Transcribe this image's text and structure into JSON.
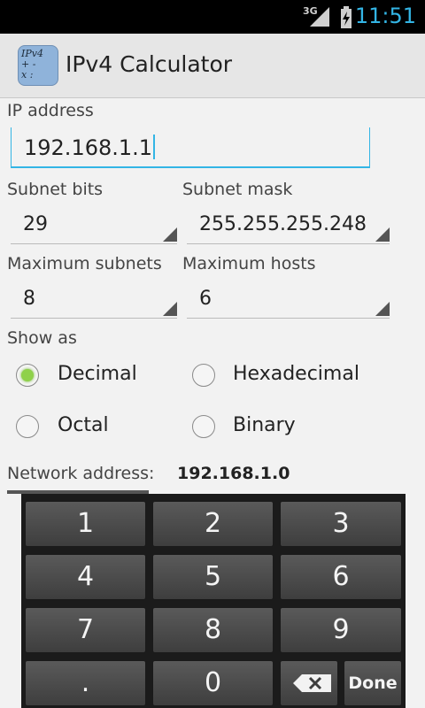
{
  "status_bar": {
    "network": "3G",
    "time": "11:51"
  },
  "app": {
    "title": "IPv4 Calculator",
    "icon_text": "IPv4\n+ -\nx :"
  },
  "ip": {
    "label": "IP address",
    "value": "192.168.1.1"
  },
  "subnet_bits": {
    "label": "Subnet bits",
    "value": "29"
  },
  "subnet_mask": {
    "label": "Subnet mask",
    "value": "255.255.255.248"
  },
  "max_subnets": {
    "label": "Maximum subnets",
    "value": "8"
  },
  "max_hosts": {
    "label": "Maximum hosts",
    "value": "6"
  },
  "show_as": {
    "label": "Show as",
    "options": [
      "Decimal",
      "Hexadecimal",
      "Octal",
      "Binary"
    ],
    "selected": "Decimal"
  },
  "results": {
    "network_label": "Network address:",
    "network_value": "192.168.1.0"
  },
  "keypad": {
    "keys": [
      "1",
      "2",
      "3",
      "4",
      "5",
      "6",
      "7",
      "8",
      "9",
      ".",
      "0"
    ],
    "done": "Done"
  },
  "colors": {
    "accent": "#33b5e5",
    "radio_checked": "#8fd14a"
  }
}
